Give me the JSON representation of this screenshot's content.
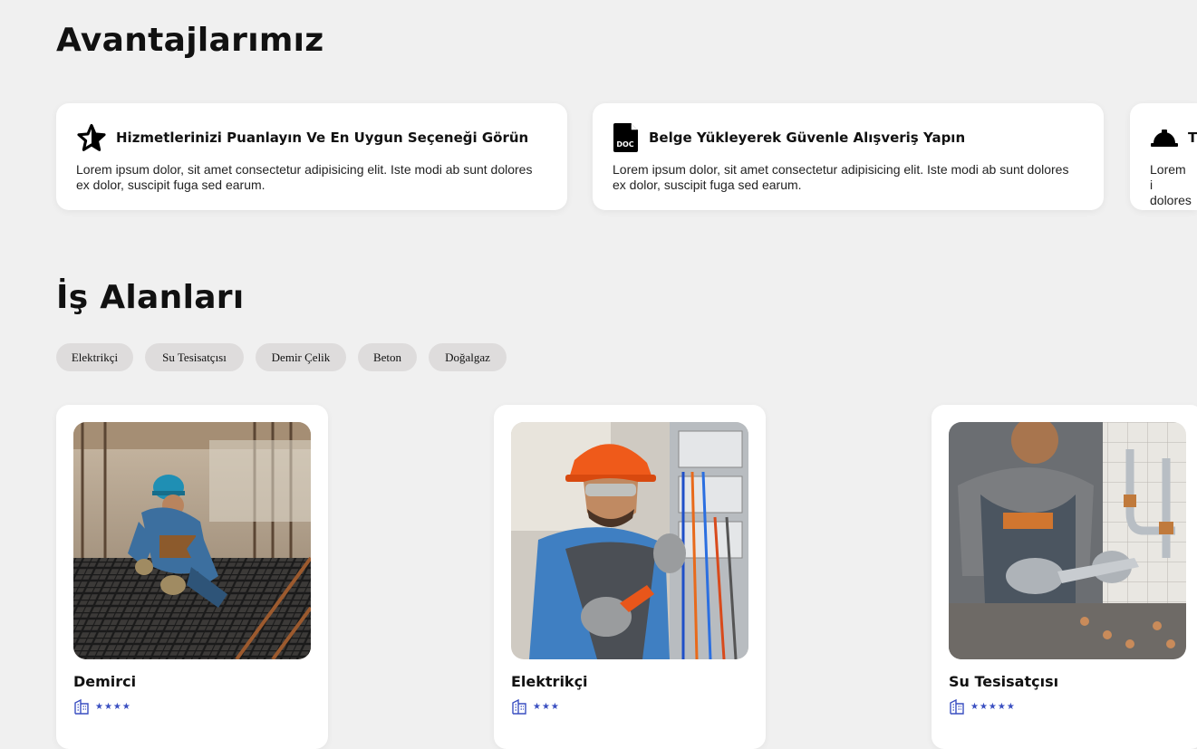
{
  "advantages": {
    "title": "Avantajlarımız",
    "cards": [
      {
        "title": "Hizmetlerinizi Puanlayın Ve En Uygun Seçeneği Görün",
        "text": "Lorem ipsum dolor, sit amet consectetur adipisicing elit. Iste modi ab sunt dolores ex dolor, suscipit fuga sed earum.",
        "icon": "star-icon"
      },
      {
        "title": "Belge Yükleyerek Güvenle Alışveriş Yapın",
        "text": "Lorem ipsum dolor, sit amet consectetur adipisicing elit. Iste modi ab sunt dolores ex dolor, suscipit fuga sed earum.",
        "icon": "doc-icon",
        "icon_label": "DOC"
      },
      {
        "title": "T",
        "text": "Lorem i dolores",
        "icon": "hard-hat-icon"
      }
    ]
  },
  "work_areas": {
    "title": "İş Alanları",
    "filters": [
      "Elektrikçi",
      "Su Tesisatçısı",
      "Demir Çelik",
      "Beton",
      "Doğalgaz"
    ],
    "jobs": [
      {
        "name": "Demirci",
        "stars": "★★★★",
        "rating": 4,
        "icon": "building-icon"
      },
      {
        "name": "Elektrikçi",
        "stars": "★★★",
        "rating": 3,
        "icon": "building-icon"
      },
      {
        "name": "Su Tesisatçısı",
        "stars": "★★★★★",
        "rating": 5,
        "icon": "building-icon"
      }
    ]
  },
  "colors": {
    "background": "#f0f0f0",
    "card": "#ffffff",
    "chip": "#dedcdc",
    "star": "#3a4fc1"
  }
}
